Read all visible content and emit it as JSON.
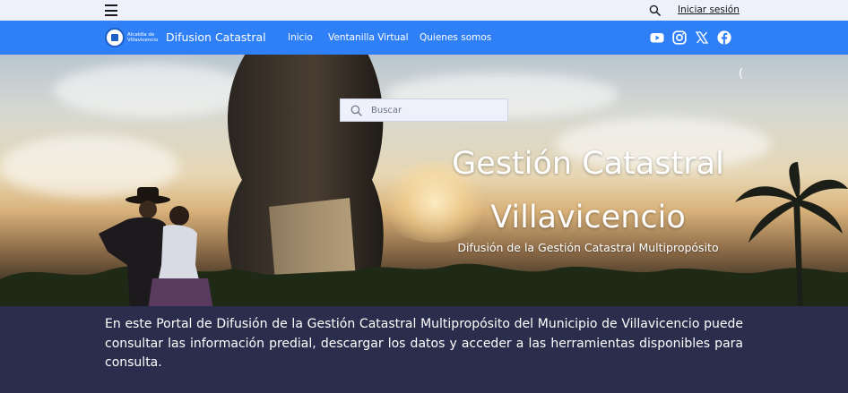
{
  "topbar": {
    "login_label": "Iniciar sesión"
  },
  "navbar": {
    "logo_text": "Alcaldía de Villavicencio",
    "site_title": "Difusion Catastral",
    "links": [
      {
        "label": "Inicio"
      },
      {
        "label": "Ventanilla Virtual"
      },
      {
        "label": "Quienes somos"
      }
    ],
    "social_icons": [
      "youtube-icon",
      "instagram-icon",
      "x-twitter-icon",
      "facebook-icon"
    ]
  },
  "hero": {
    "search_placeholder": "Buscar",
    "title": "Gestión Catastral Villavicencio",
    "subtitle": "Difusión de la Gestión Catastral Multipropósito",
    "spinner_glyph": "("
  },
  "info": {
    "text": "En este Portal de Difusión de la Gestión Catastral Multipropósito del Municipio de Villavicencio puede consultar las información predial, descargar los datos y acceder a las herramientas disponibles para consulta."
  },
  "colors": {
    "topbar_bg": "#eef0fb",
    "nav_bg": "#2f80f7",
    "info_bg": "#2b2d4c"
  }
}
